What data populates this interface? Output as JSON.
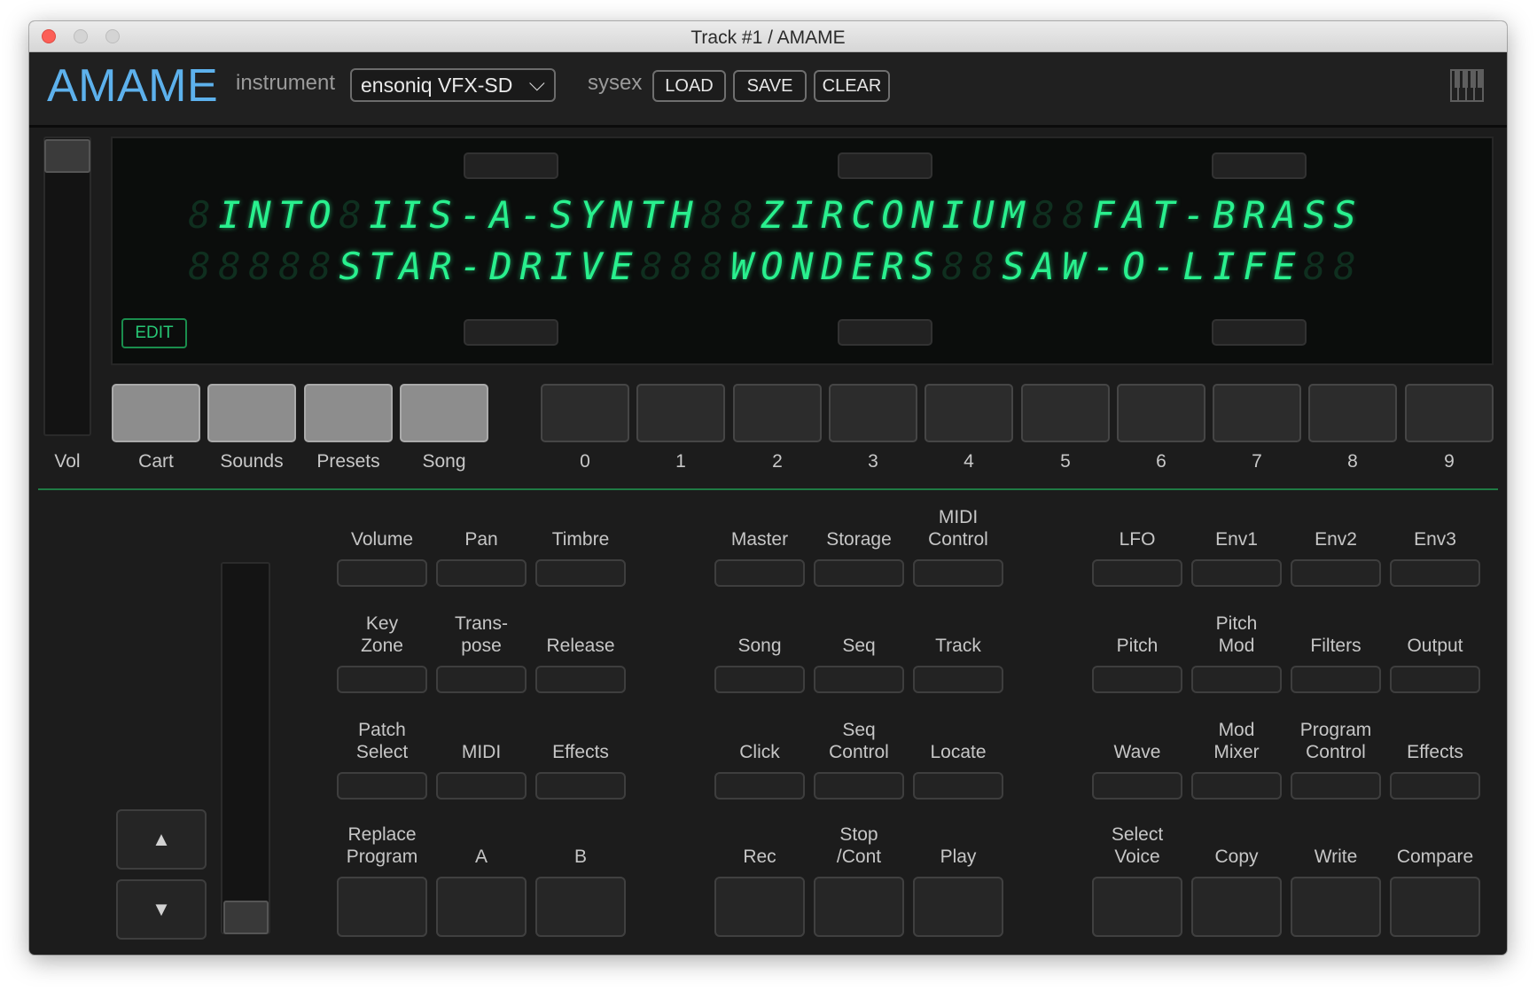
{
  "window": {
    "title": "Track #1 / AMAME"
  },
  "header": {
    "logo": "AMAME",
    "instrument_label": "instrument",
    "instrument_value": "ensoniq VFX-SD",
    "sysex_label": "sysex",
    "load_label": "LOAD",
    "save_label": "SAVE",
    "clear_label": "CLEAR"
  },
  "display": {
    "line1": " INTO IIS-A-SYNTH  ZIRCONIUM  FAT-BRASS ",
    "line2": "     STAR-DRIVE   WONDERS  SAW-O-LIFE ",
    "edit_label": "EDIT",
    "segment_color": "#29f08e"
  },
  "bank_pads": {
    "vol_label": "Vol",
    "buttons": [
      "Cart",
      "Sounds",
      "Presets",
      "Song"
    ]
  },
  "number_pads": [
    "0",
    "1",
    "2",
    "3",
    "4",
    "5",
    "6",
    "7",
    "8",
    "9"
  ],
  "control_grid": {
    "group1": [
      [
        "Volume",
        "Pan",
        "Timbre"
      ],
      [
        "Key\nZone",
        "Trans-\npose",
        "Release"
      ],
      [
        "Patch\nSelect",
        "MIDI",
        "Effects"
      ],
      [
        "Replace\nProgram",
        "A",
        "B"
      ]
    ],
    "group2": [
      [
        "Master",
        "Storage",
        "MIDI\nControl"
      ],
      [
        "Song",
        "Seq",
        "Track"
      ],
      [
        "Click",
        "Seq\nControl",
        "Locate"
      ],
      [
        "Rec",
        "Stop\n/Cont",
        "Play"
      ]
    ],
    "group3": [
      [
        "LFO",
        "Env1",
        "Env2",
        "Env3"
      ],
      [
        "Pitch",
        "Pitch\nMod",
        "Filters",
        "Output"
      ],
      [
        "Wave",
        "Mod\nMixer",
        "Program\nControl",
        "Effects"
      ],
      [
        "Select\nVoice",
        "Copy",
        "Write",
        "Compare"
      ]
    ]
  },
  "data_entry": {
    "up_glyph": "▲",
    "down_glyph": "▼"
  },
  "colors": {
    "accent": "#5db1ec",
    "display_green": "#29f08e",
    "divider": "#1f7a44"
  }
}
